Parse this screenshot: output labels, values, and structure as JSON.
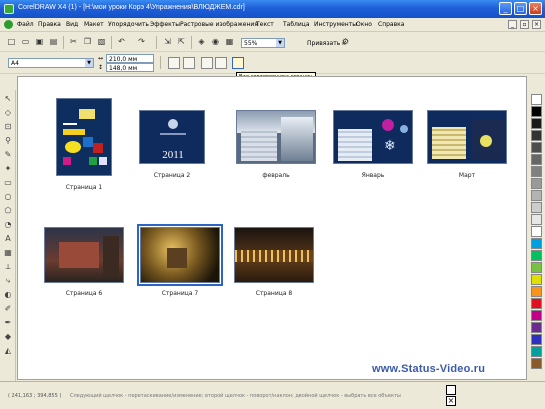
{
  "window": {
    "title": "CorelDRAW X4 (1) - [Н:\\мои уроки Корэ 4\\Упражнения\\ВЛЮДЖЕМ.cdr]",
    "minimize": "_",
    "maximize": "□",
    "close": "×"
  },
  "menu": {
    "items": [
      "Файл",
      "Правка",
      "Вид",
      "Макет",
      "Упорядочить",
      "Эффекты",
      "Растровые изображения",
      "Текст",
      "Таблица",
      "Инструменты",
      "Окно",
      "Справка"
    ]
  },
  "toolbar": {
    "zoom": "55%",
    "snap": "Привязать к",
    "font": "A4",
    "width": "210,0 мм",
    "height": "148,0 мм"
  },
  "tooltip": "Вид сортировщика страниц",
  "pages": [
    {
      "label": "Страница 1"
    },
    {
      "label": "Страница 2",
      "year": "2011"
    },
    {
      "label": "февраль"
    },
    {
      "label": "Январь"
    },
    {
      "label": "Март"
    },
    {
      "label": "Страница 6"
    },
    {
      "label": "Страница 7"
    },
    {
      "label": "Страница 8"
    }
  ],
  "watermark": "www.Status-Video.ru",
  "status": {
    "coords": "( 241,163 ; 394,855 )",
    "hint": "Следующий щелчок - перетаскивание/изменение; второй щелчок - поворот/наклон; двойной щелчок - выбрать все объекты"
  },
  "palette": [
    "#ffffff",
    "#000000",
    "#1a1a1a",
    "#333333",
    "#4d4d4d",
    "#666666",
    "#808080",
    "#999999",
    "#b3b3b3",
    "#cccccc",
    "#e6e6e6",
    "#ffffff",
    "#00a0e0",
    "#00c060",
    "#7ac143",
    "#e0e000",
    "#f7941d",
    "#e01020",
    "#c0008a",
    "#6a2c91",
    "#3030c0",
    "#00a0a0",
    "#8b5a2b"
  ]
}
